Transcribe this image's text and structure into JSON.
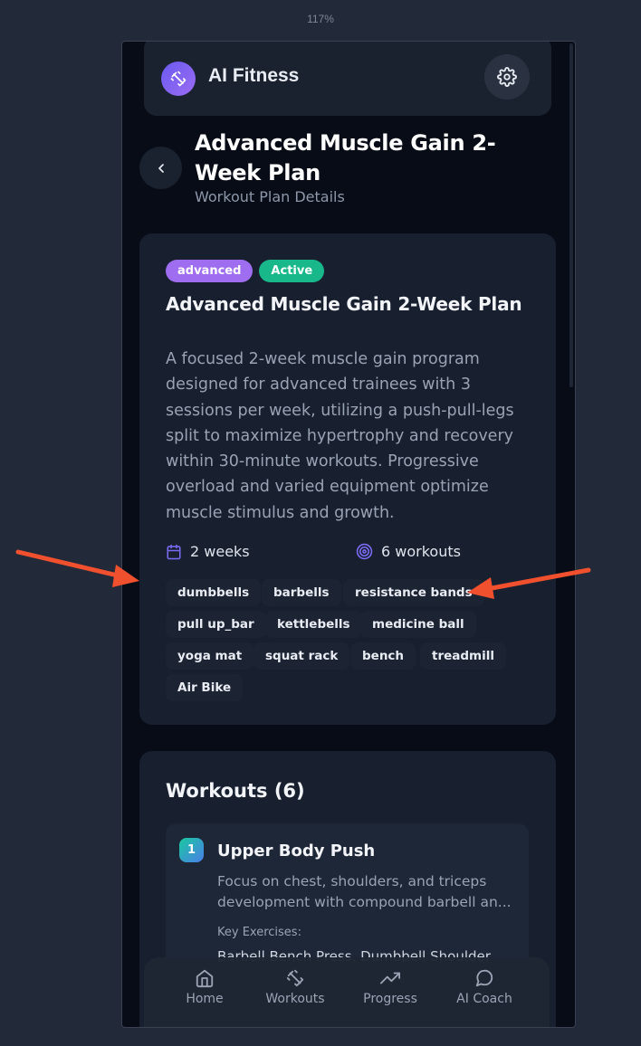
{
  "zoom": "117%",
  "app": {
    "title": "AI Fitness",
    "icons": {
      "logo": "dumbbell-icon",
      "settings": "gear-icon"
    }
  },
  "header": {
    "title": "Advanced Muscle Gain 2-Week Plan",
    "subtitle": "Workout Plan Details",
    "back_icon": "chevron-left-icon"
  },
  "plan": {
    "level_badge": "advanced",
    "status_badge": "Active",
    "title": "Advanced Muscle Gain 2-Week Plan",
    "description": "A focused 2-week muscle gain program designed for advanced trainees with 3 sessions per week, utilizing a push-pull-legs split to maximize hypertrophy and recovery within 30-minute workouts. Progressive overload and varied equipment optimize muscle stimulus and growth.",
    "duration": "2 weeks",
    "workout_count": "6 workouts",
    "equipment": [
      "dumbbells",
      "barbells",
      "resistance bands",
      "pull up_bar",
      "kettlebells",
      "medicine ball",
      "yoga mat",
      "squat rack",
      "bench",
      "treadmill",
      "Air Bike"
    ]
  },
  "workouts_section": {
    "title": "Workouts (6)",
    "items": [
      {
        "number": "1",
        "title": "Upper Body Push",
        "description": "Focus on chest, shoulders, and triceps development with compound barbell an...",
        "key_label": "Key Exercises:",
        "key_exercises": "Barbell Bench Press, Dumbbell Shoulder"
      }
    ]
  },
  "nav": [
    {
      "label": "Home",
      "icon": "home-icon"
    },
    {
      "label": "Workouts",
      "icon": "dumbbell-icon"
    },
    {
      "label": "Progress",
      "icon": "trending-up-icon"
    },
    {
      "label": "AI Coach",
      "icon": "chat-bubble-icon"
    }
  ],
  "colors": {
    "background": "#222938",
    "screen": "#070c16",
    "card": "#182030",
    "level_badge": "#9f6ef0",
    "status_badge": "#18b88a",
    "annotation_arrow": "#f0502e"
  }
}
